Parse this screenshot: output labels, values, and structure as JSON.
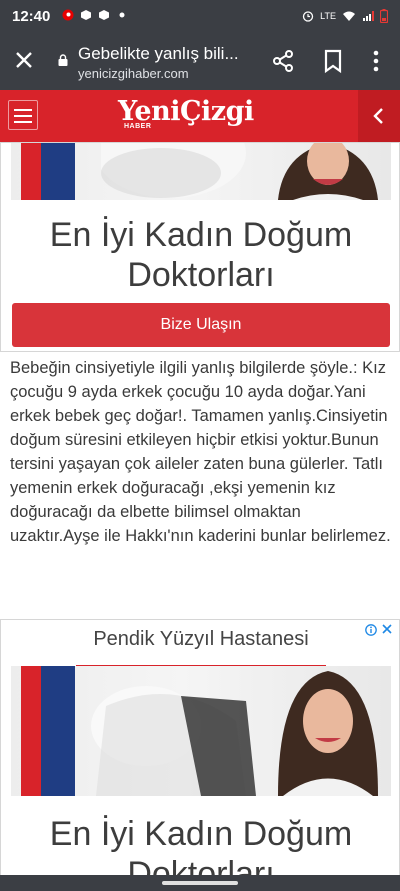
{
  "status_bar": {
    "time": "12:40",
    "network": "LTE"
  },
  "browser": {
    "close_icon": "close-icon",
    "title": "Gebelikte yanlış bili...",
    "url": "yenicizgihaber.com",
    "share_icon": "share-icon",
    "bookmark_icon": "bookmark-icon",
    "menu_icon": "more-vert-icon"
  },
  "site_header": {
    "logo_text": "YeniÇizgi",
    "logo_sub": "HABER",
    "menu_icon": "hamburger-menu-icon",
    "back_icon": "chevron-left-icon",
    "brand_color": "#d8232a"
  },
  "ad_top": {
    "headline": "En İyi Kadın Doğum Doktorları",
    "cta_label": "Bize Ulaşın"
  },
  "article": {
    "paragraph": "Bebeğin cinsiyetiyle ilgili yanlış bilgilerde şöyle.: Kız çocuğu 9 ayda  erkek çocuğu 10 ayda doğar.Yani erkek bebek geç doğar!. Tamamen yanlış.Cinsiyetin doğum süresini etkileyen hiçbir etkisi yoktur.Bunun tersini yaşayan çok aileler zaten buna gülerler.   Tatlı yemenin erkek doğuracağı ,ekşi yemenin kız doğuracağı da elbette bilimsel olmaktan uzaktır.Ayşe ile Hakkı'nın kaderini bunlar belirlemez."
  },
  "ad_bottom": {
    "sponsor": "Pendik Yüzyıl Hastanesi",
    "headline": "En İyi Kadın Doğum Doktorları",
    "adchoices_icon": "adchoices-icon",
    "close_icon": "close-icon"
  }
}
